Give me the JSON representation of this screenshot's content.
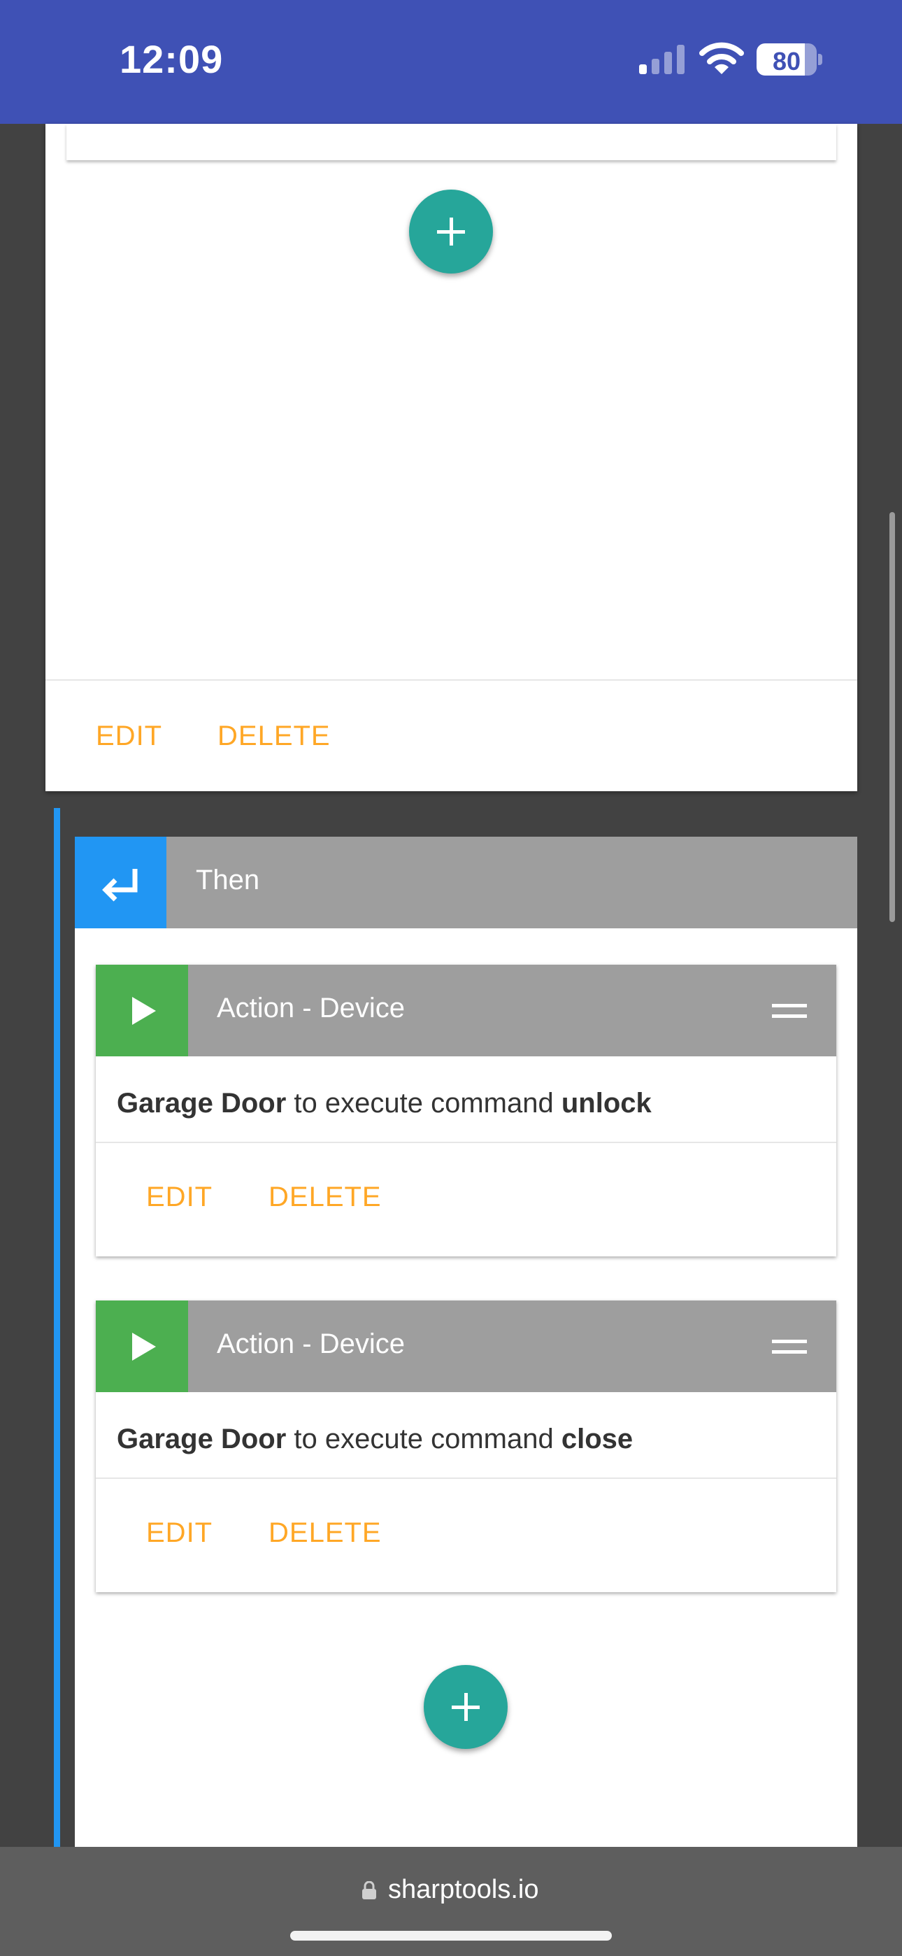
{
  "status_bar": {
    "time": "12:09",
    "battery": "80",
    "battery_level": 0.8
  },
  "top_card": {
    "edit_label": "EDIT",
    "delete_label": "DELETE"
  },
  "then_block": {
    "title": "Then",
    "actions": [
      {
        "title": "Action - Device",
        "device": "Garage Door",
        "text": " to execute command ",
        "command": "unlock",
        "edit_label": "EDIT",
        "delete_label": "DELETE"
      },
      {
        "title": "Action - Device",
        "device": "Garage Door",
        "text": " to execute command ",
        "command": "close",
        "edit_label": "EDIT",
        "delete_label": "DELETE"
      }
    ]
  },
  "browser": {
    "url": "sharptools.io"
  },
  "colors": {
    "header_blue": "#3f51b5",
    "accent_blue": "#2196f3",
    "fab_teal": "#26a69a",
    "action_orange": "#ffa726",
    "play_green": "#4caf50",
    "header_gray": "#9e9e9e"
  }
}
